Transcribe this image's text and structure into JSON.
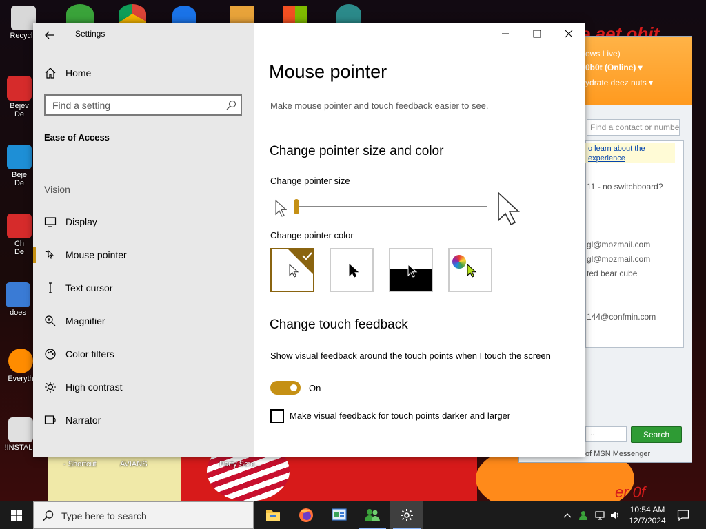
{
  "desktop": {
    "icons": [
      {
        "label": "Recycle",
        "color": "#d8d8d8"
      },
      {
        "label": "Bejev\nDe",
        "color": "#d62b2b"
      },
      {
        "label": "Beje\nDe",
        "color": "#1e8fd6"
      },
      {
        "label": "Ch\nDe",
        "color": "#d62b2b"
      },
      {
        "label": "does",
        "color": "#3a7bd5"
      },
      {
        "label": "Everyth",
        "color": "#ff8c00"
      },
      {
        "label": "!INSTALL",
        "color": "#e0e0e0"
      }
    ],
    "bottom_labels": [
      "- Shortcut",
      "AVIANS",
      "Party Scre..."
    ],
    "wallpaper_text": "e aet ohit",
    "wallpaper_text2": "er 0f"
  },
  "msn": {
    "header_lines": [
      "ows Live)",
      "0b0t  (Online) ▾",
      "ydrate deez nuts ▾"
    ],
    "find_placeholder": "Find a contact or numbe",
    "link": "o learn about the experience",
    "items": [
      "11 - no switchboard?",
      "gl@mozmail.com",
      "gl@mozmail.com",
      "ted bear cube",
      "144@confmin.com"
    ],
    "search_input": "...",
    "search_button": "Search",
    "footer": "of MSN Messenger"
  },
  "settings": {
    "app_title": "Settings",
    "home_label": "Home",
    "search_placeholder": "Find a setting",
    "section": "Ease of Access",
    "group": "Vision",
    "nav": [
      {
        "label": "Display",
        "icon": "display-icon"
      },
      {
        "label": "Mouse pointer",
        "icon": "mouse-pointer-icon",
        "active": true
      },
      {
        "label": "Text cursor",
        "icon": "text-cursor-icon"
      },
      {
        "label": "Magnifier",
        "icon": "magnifier-icon"
      },
      {
        "label": "Color filters",
        "icon": "color-filters-icon"
      },
      {
        "label": "High contrast",
        "icon": "high-contrast-icon"
      },
      {
        "label": "Narrator",
        "icon": "narrator-icon"
      }
    ],
    "accent_color": "#c59014"
  },
  "page": {
    "title": "Mouse pointer",
    "description": "Make mouse pointer and touch feedback easier to see.",
    "pointer_section": "Change pointer size and color",
    "size_label": "Change pointer size",
    "size_value": 0.0,
    "color_label": "Change pointer color",
    "color_options": [
      "white",
      "black",
      "inverted",
      "custom"
    ],
    "selected_color": "white",
    "touch_section": "Change touch feedback",
    "touch_desc": "Show visual feedback around the touch points when I touch the screen",
    "toggle_state": "On",
    "checkbox_label": "Make visual feedback for touch points darker and larger",
    "checkbox_checked": false
  },
  "taskbar": {
    "search_placeholder": "Type here to search",
    "time": "10:54 AM",
    "date": "12/7/2024",
    "apps": [
      "file-explorer-icon",
      "firefox-icon",
      "control-panel-icon",
      "msn-messenger-icon",
      "settings-icon"
    ]
  }
}
